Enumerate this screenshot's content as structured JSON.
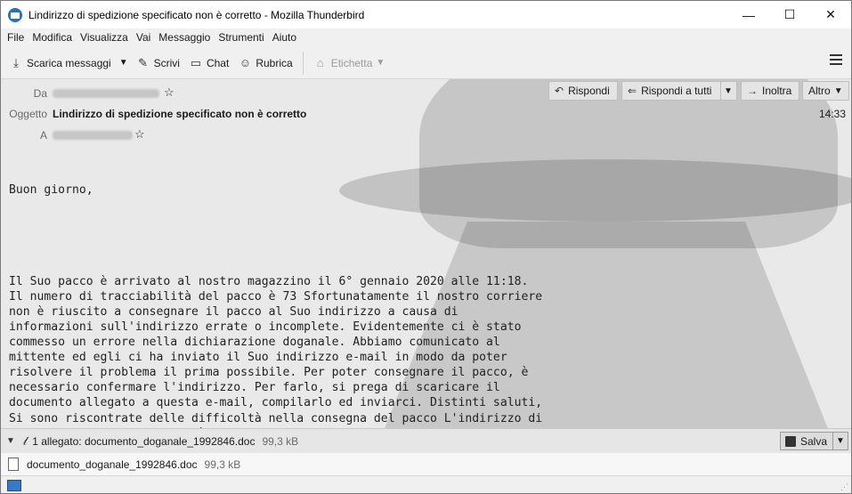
{
  "window": {
    "title": "Lindirizzo di spedizione specificato non è corretto - Mozilla Thunderbird",
    "controls": {
      "minimize": "—",
      "maximize": "☐",
      "close": "✕"
    }
  },
  "menu": [
    "File",
    "Modifica",
    "Visualizza",
    "Vai",
    "Messaggio",
    "Strumenti",
    "Aiuto"
  ],
  "toolbar": {
    "get_messages": "Scarica messaggi",
    "write": "Scrivi",
    "chat": "Chat",
    "address_book": "Rubrica",
    "tag": "Etichetta"
  },
  "header": {
    "from_label": "Da",
    "subject_label": "Oggetto",
    "subject": "Lindirizzo di spedizione specificato non è corretto",
    "to_label": "A",
    "time": "14:33",
    "reply": "Rispondi",
    "reply_all": "Rispondi a tutti",
    "forward": "Inoltra",
    "more": "Altro"
  },
  "body": {
    "greeting": "Buon giorno,",
    "text": "Il Suo pacco è arrivato al nostro magazzino il 6° gennaio 2020 alle 11:18.\nIl numero di tracciabilità del pacco è 73 Sfortunatamente il nostro corriere\nnon è riuscito a consegnare il pacco al Suo indirizzo a causa di\ninformazioni sull'indirizzo errate o incomplete. Evidentemente ci è stato\ncommesso un errore nella dichiarazione doganale. Abbiamo comunicato al\nmittente ed egli ci ha inviato il Suo indirizzo e-mail in modo da poter\nrisolvere il problema il prima possibile. Per poter consegnare il pacco, è\nnecessario confermare l'indirizzo. Per farlo, si prega di scaricare il\ndocumento allegato a questa e-mail, compilarlo ed inviarci. Distinti saluti,\nSi sono riscontrate delle difficoltà nella consegna del pacco L'indirizzo di\nspedizione specificato non è corretto Non siamo riusciti a consegnare il\npacco"
  },
  "attachments": {
    "summary": "1 allegato: documento_doganale_1992846.doc",
    "summary_size": "99,3 kB",
    "save": "Salva",
    "items": [
      {
        "name": "documento_doganale_1992846.doc",
        "size": "99,3 kB"
      }
    ]
  }
}
